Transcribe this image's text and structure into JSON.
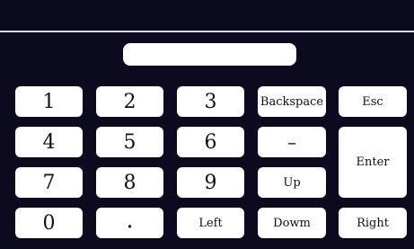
{
  "display": {
    "value": ""
  },
  "keys": {
    "one": "1",
    "two": "2",
    "three": "3",
    "backspace": "Backspace",
    "esc": "Esc",
    "four": "4",
    "five": "5",
    "six": "6",
    "minus": "–",
    "enter": "Enter",
    "seven": "7",
    "eight": "8",
    "nine": "9",
    "up": "Up",
    "zero": "0",
    "dot": ".",
    "left": "Left",
    "down": "Dowm",
    "right": "Right"
  }
}
